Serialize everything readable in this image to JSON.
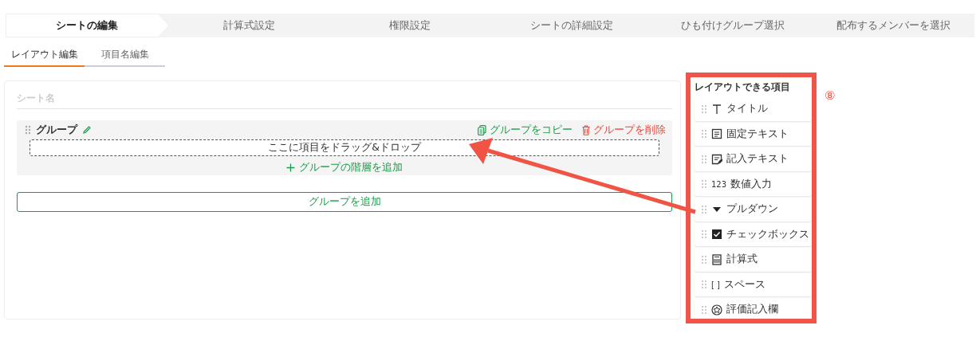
{
  "steps": [
    {
      "label": "シートの編集",
      "selected": true
    },
    {
      "label": "計算式設定",
      "selected": false
    },
    {
      "label": "権限設定",
      "selected": false
    },
    {
      "label": "シートの詳細設定",
      "selected": false
    },
    {
      "label": "ひも付けグループ選択",
      "selected": false
    },
    {
      "label": "配布するメンバーを選択",
      "selected": false
    }
  ],
  "subtabs": [
    {
      "label": "レイアウト編集",
      "selected": true
    },
    {
      "label": "項目名編集",
      "selected": false
    }
  ],
  "sheet_name": {
    "placeholder": "シート名"
  },
  "group": {
    "name": "グループ",
    "copy": "グループをコピー",
    "delete": "グループを削除",
    "drop_zone": "ここに項目をドラッグ&ドロップ",
    "add_level": "グループの階層を追加"
  },
  "add_group": "グループを追加",
  "palette": {
    "title": "レイアウトできる項目",
    "items": [
      {
        "kind": "title",
        "label": "タイトル"
      },
      {
        "kind": "fixed-text",
        "label": "固定テキスト"
      },
      {
        "kind": "entry-text",
        "label": "記入テキスト"
      },
      {
        "kind": "number",
        "icon_text": "123",
        "label": "数値入力"
      },
      {
        "kind": "dropdown",
        "label": "プルダウン"
      },
      {
        "kind": "checkbox",
        "label": "チェックボックス"
      },
      {
        "kind": "formula",
        "label": "計算式"
      },
      {
        "kind": "space",
        "icon_text": "[ ]",
        "label": "スペース"
      },
      {
        "kind": "rating",
        "label": "評価記入欄"
      }
    ]
  },
  "annotation": {
    "marker": "⑧"
  }
}
